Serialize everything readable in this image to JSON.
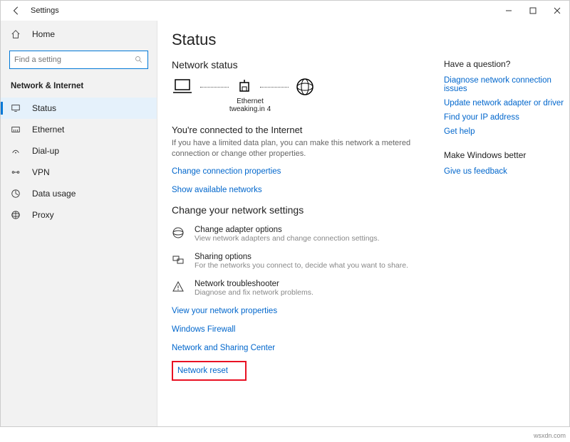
{
  "window": {
    "title": "Settings"
  },
  "sidebar": {
    "home": "Home",
    "search_placeholder": "Find a setting",
    "category": "Network & Internet",
    "items": [
      {
        "label": "Status"
      },
      {
        "label": "Ethernet"
      },
      {
        "label": "Dial-up"
      },
      {
        "label": "VPN"
      },
      {
        "label": "Data usage"
      },
      {
        "label": "Proxy"
      }
    ]
  },
  "main": {
    "page_title": "Status",
    "network_status": "Network status",
    "conn_name": "Ethernet",
    "conn_sub": "tweaking.in 4",
    "connected_head": "You're connected to the Internet",
    "connected_desc": "If you have a limited data plan, you can make this network a metered connection or change other properties.",
    "link_change_props": "Change connection properties",
    "link_show_networks": "Show available networks",
    "change_settings": "Change your network settings",
    "options": [
      {
        "title": "Change adapter options",
        "desc": "View network adapters and change connection settings."
      },
      {
        "title": "Sharing options",
        "desc": "For the networks you connect to, decide what you want to share."
      },
      {
        "title": "Network troubleshooter",
        "desc": "Diagnose and fix network problems."
      }
    ],
    "link_view_props": "View your network properties",
    "link_firewall": "Windows Firewall",
    "link_sharing_center": "Network and Sharing Center",
    "link_reset": "Network reset"
  },
  "aside": {
    "q_head": "Have a question?",
    "links1": [
      "Diagnose network connection issues",
      "Update network adapter or driver",
      "Find your IP address",
      "Get help"
    ],
    "better_head": "Make Windows better",
    "links2": [
      "Give us feedback"
    ]
  },
  "attribution": "wsxdn.com"
}
